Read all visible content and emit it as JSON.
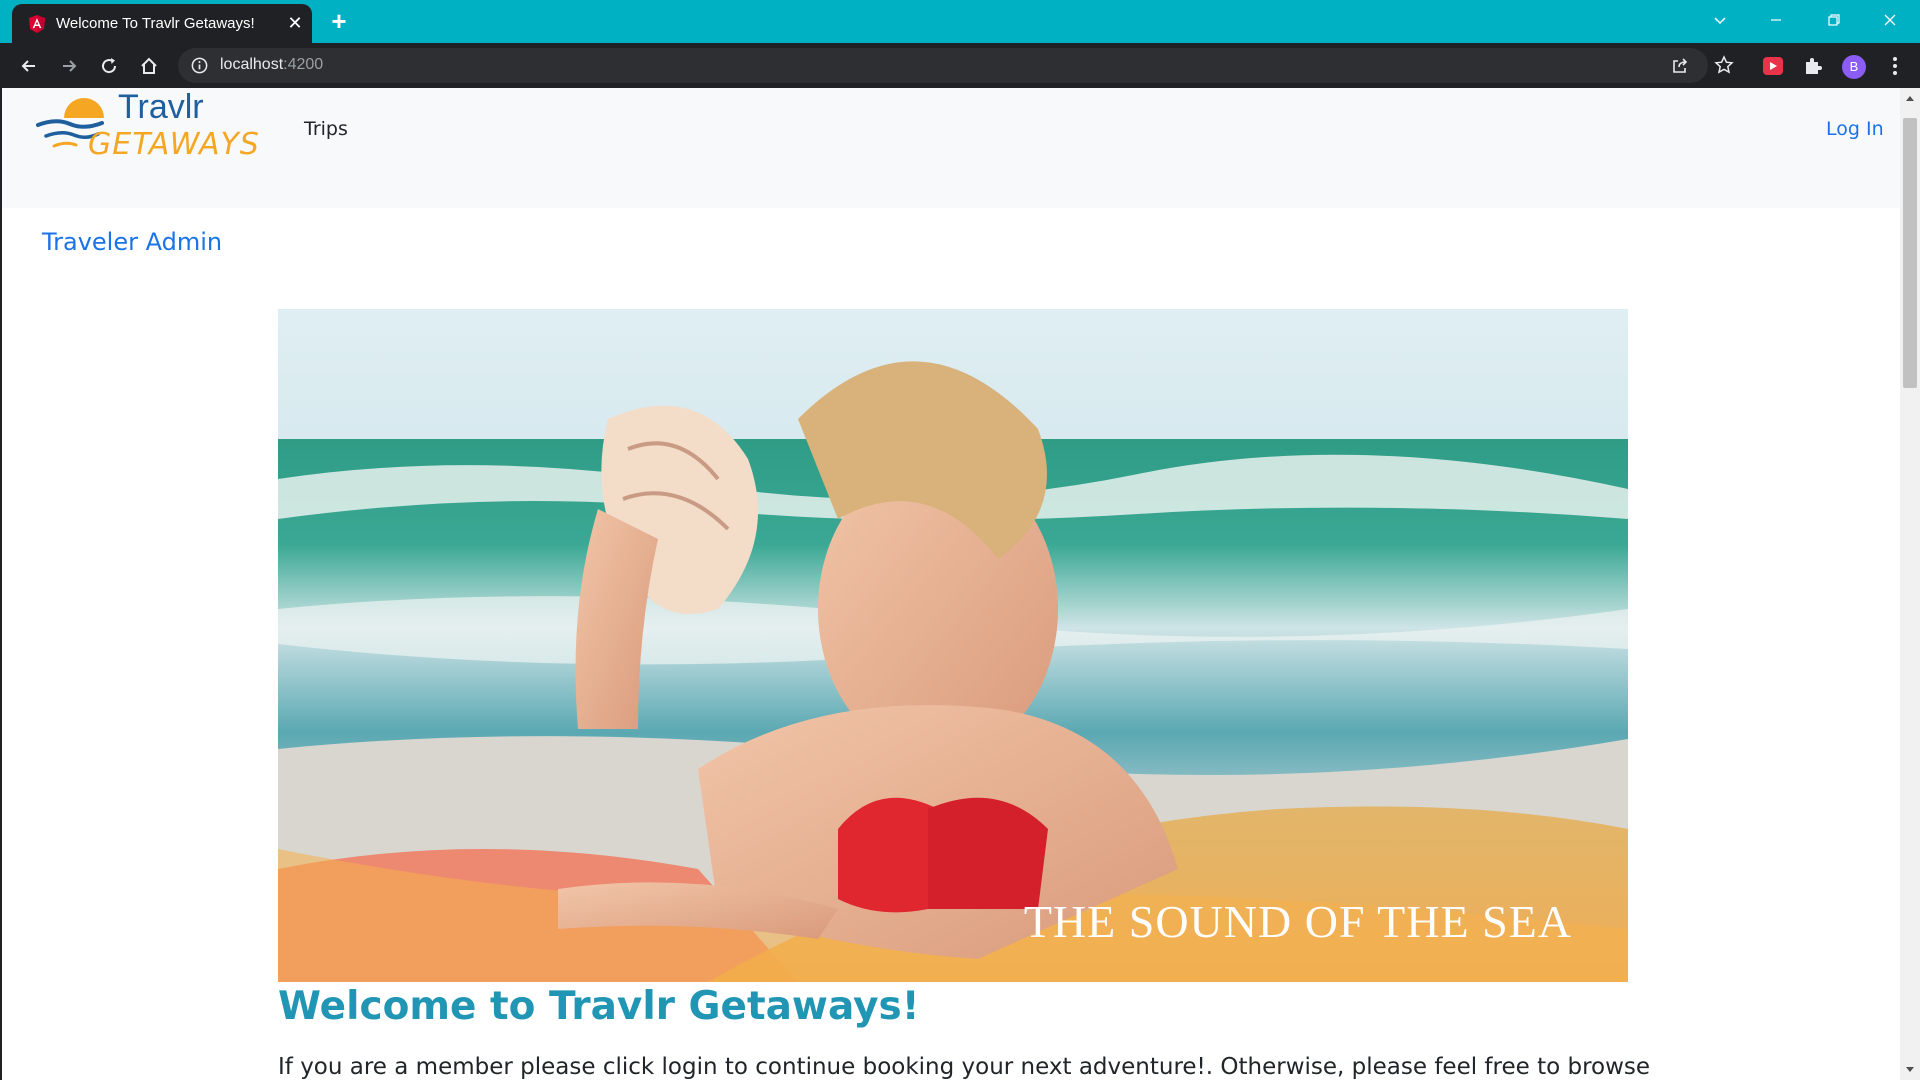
{
  "browser": {
    "tab_title": "Welcome To Travlr Getaways!",
    "url_host": "localhost",
    "url_port": ":4200",
    "profile_initial": "B",
    "accent_color": "#00b1c4"
  },
  "site": {
    "logo_text_top": "Travlr",
    "logo_text_bottom": "GETAWAYS",
    "nav_trips": "Trips",
    "nav_login": "Log In",
    "admin_link": "Traveler Admin"
  },
  "hero": {
    "caption": "THE SOUND OF THE SEA"
  },
  "content": {
    "welcome_heading": "Welcome to Travlr Getaways!",
    "intro_text": "If you are a member please click login to continue booking your next adventure!. Otherwise, please feel free to browse"
  }
}
